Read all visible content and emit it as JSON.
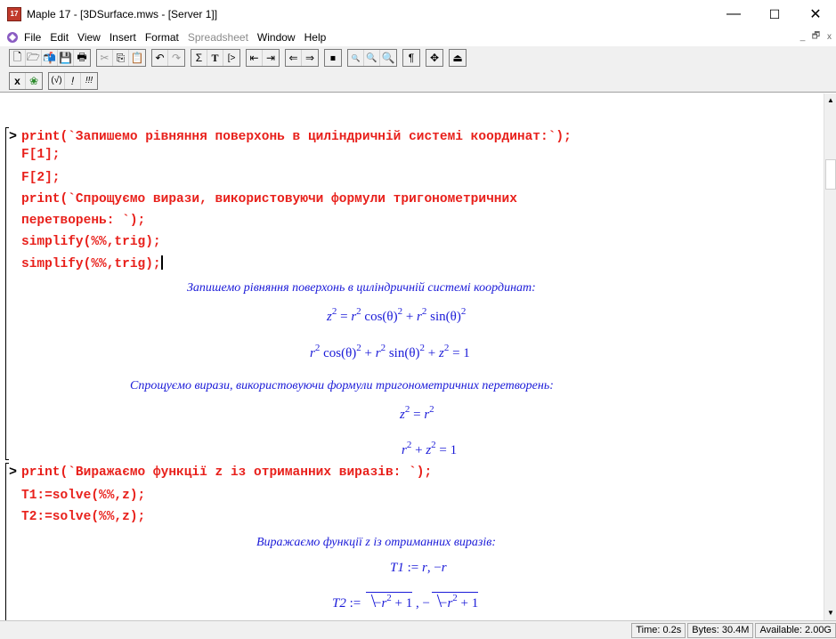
{
  "window": {
    "title": "Maple 17 - [3DSurface.mws - [Server 1]]",
    "app_icon_label": "17",
    "minimize": "—",
    "maximize": "☐",
    "close": "✕"
  },
  "menu": {
    "items": [
      "File",
      "Edit",
      "View",
      "Insert",
      "Format",
      "Spreadsheet",
      "Window",
      "Help"
    ],
    "disabled_index": 5,
    "mdi_minimize": "_",
    "mdi_restore": "🗗",
    "mdi_close": "x"
  },
  "toolbar1": {
    "groups": [
      [
        "🗋",
        "🗁",
        "📬",
        "💾",
        "🖶"
      ],
      [
        "✂",
        "⎘",
        "📋"
      ],
      [
        "↶",
        "↷"
      ],
      [
        "Σ",
        "T",
        "[>"
      ],
      [
        "⇤",
        "⇥"
      ],
      [
        "⇐",
        "⇒"
      ],
      [
        "⏹"
      ],
      [
        "🔍",
        "🔍",
        "🔍"
      ],
      [
        "¶"
      ],
      [
        "✥"
      ],
      [
        "⏏"
      ]
    ]
  },
  "toolbar2": {
    "groups": [
      [
        "x",
        "❀"
      ],
      [
        "(√)",
        "!",
        "!!!"
      ]
    ]
  },
  "worksheet": {
    "group1": {
      "prompt": ">",
      "lines": [
        "print(`Запишемо рівняння поверхонь в циліндричній системі координат:`);",
        "F[1];",
        "F[2];",
        "print(`Спрощуємо вирази, використовуючи формули тригонометричних",
        "перетворень: `);",
        "simplify(%%,trig);",
        "simplify(%%,trig);"
      ],
      "out_text1": "Запишемо рівняння поверхонь в циліндричній системі координат:",
      "out_text2": "Спрощуємо вирази, використовуючи формули тригонометричних перетворень:"
    },
    "group2": {
      "prompt": ">",
      "lines": [
        "print(`Виражаємо функції z із отриманних виразів: `);",
        "T1:=solve(%%,z);",
        "T2:=solve(%%,z);"
      ],
      "out_text": "Виражаємо функції z із отриманних виразів:"
    }
  },
  "status": {
    "time": "Time: 0.2s",
    "bytes": "Bytes: 30.4M",
    "available": "Available: 2.00G"
  },
  "colors": {
    "input": "#e8201b",
    "output": "#1a1ad8"
  }
}
